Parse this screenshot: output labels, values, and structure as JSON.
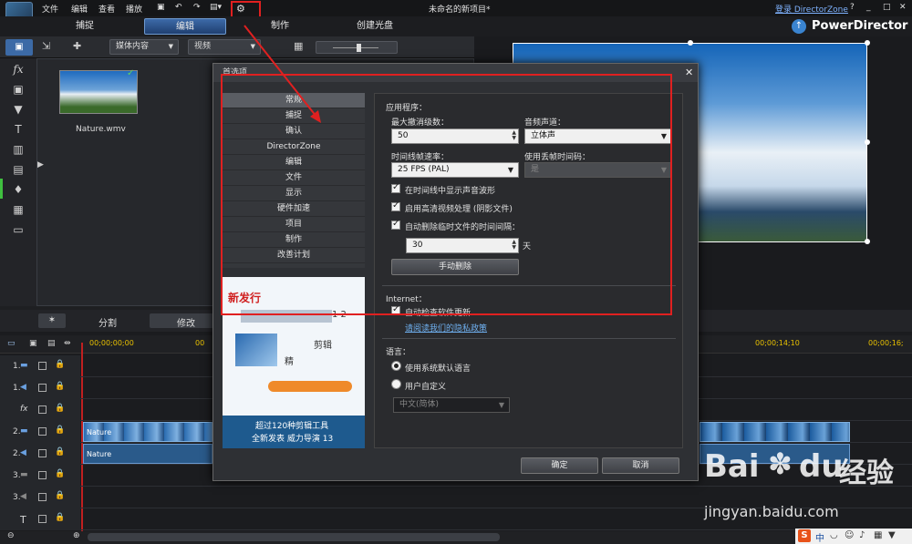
{
  "menu": {
    "file": "文件",
    "edit": "编辑",
    "view": "查看",
    "play": "播放"
  },
  "window": {
    "title": "未命名的新项目*",
    "login": "登录 DirectorZone",
    "help": "?",
    "brand": "PowerDirector"
  },
  "modes": {
    "capture": "捕捉",
    "edit": "编辑",
    "produce": "制作",
    "disc": "创建光盘"
  },
  "library": {
    "media_select": "媒体内容",
    "video_select": "视频",
    "clip_name": "Nature.wmv"
  },
  "lower_tabs": {
    "split": "分割",
    "modify": "修改"
  },
  "timeline": {
    "time_start": "00;00;00;00",
    "time_mid": "00;00;14;10",
    "time_end": "00;00;16;",
    "time_left_partial": "00",
    "clip_video": "Nature",
    "clip_audio": "Nature",
    "track_labels": [
      "1.",
      "1.",
      "fx",
      "2.",
      "2.",
      "3.",
      "3.",
      "T"
    ]
  },
  "dialog": {
    "title": "首选项",
    "close": "✕",
    "categories": [
      "常规",
      "捕捉",
      "确认",
      "DirectorZone",
      "编辑",
      "文件",
      "显示",
      "硬件加速",
      "项目",
      "制作",
      "改善计划"
    ],
    "promo": {
      "headline": "新发行",
      "caption1": "超过120种剪辑工具",
      "caption2": "全新发表  威力导演  13",
      "blur_a": "1 2",
      "blur_b": "剪辑",
      "blur_c": "精"
    },
    "app_section": "应用程序：",
    "max_undo_label": "最大撤消级数：",
    "max_undo_value": "50",
    "audio_channel_label": "音频声道：",
    "audio_channel_value": "立体声",
    "fps_label": "时间线帧速率：",
    "fps_value": "25 FPS (PAL)",
    "dropframe_label": "使用丢帧时间码：",
    "dropframe_value": "是",
    "cb_waveform": "在时间线中显示声音波形",
    "cb_hd": "启用高清视频处理 (阴影文件)",
    "cb_autodelete": "自动删除临时文件的时间间隔：",
    "days_value": "30",
    "days_unit": "天",
    "manual_delete": "手动删除",
    "internet_section": "Internet：",
    "cb_autoupdate": "自动检查软件更新",
    "privacy_link": "请阅读我们的隐私政策",
    "language_section": "语言：",
    "radio_system": "使用系统默认语言",
    "radio_custom": "用户自定义",
    "lang_value": "中文(简体)",
    "ok": "确定",
    "cancel": "取消"
  },
  "watermark": {
    "brand": "Bai",
    "brand2": "du",
    "brand3": "经验",
    "url": "jingyan.baidu.com"
  },
  "ime": {
    "s": "S",
    "zh": "中"
  },
  "colors": {
    "highlight_red": "#e02020",
    "accent_blue": "#3d6aa8"
  }
}
